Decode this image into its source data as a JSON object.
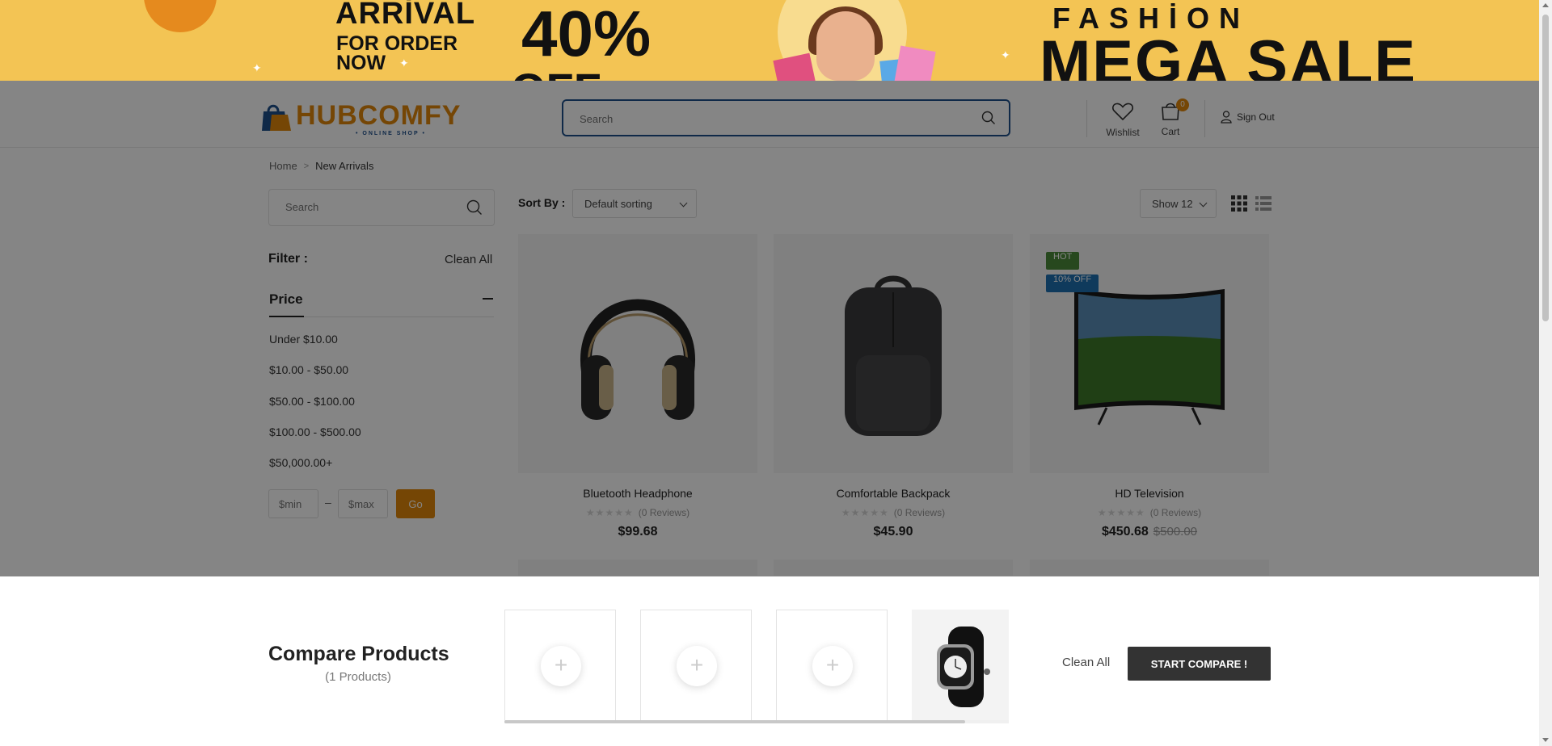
{
  "banner": {
    "arrival": "ARRİVAL",
    "for_order": "FOR ORDER",
    "now": "NOW",
    "percent": "40%",
    "off": "OFF",
    "fashion": "FASHİON",
    "mega_sale": "MEGA SALE",
    "bg_color": "#f3c454"
  },
  "header": {
    "logo_text": "HUBCOMFY",
    "logo_sub": "• ONLINE SHOP •",
    "search_placeholder": "Search",
    "wishlist_label": "Wishlist",
    "cart_label": "Cart",
    "cart_count": "0",
    "signout_label": "Sign Out",
    "accent_color": "#e0860a",
    "brand_color": "#1e4f8b"
  },
  "breadcrumb": {
    "home": "Home",
    "current": "New Arrivals"
  },
  "sidebar": {
    "search_placeholder": "Search",
    "filter_label": "Filter :",
    "clean_all": "Clean All",
    "price_title": "Price",
    "price_options": [
      "Under $10.00",
      "$10.00 - $50.00",
      "$50.00 - $100.00",
      "$100.00 - $500.00",
      "$50,000.00+"
    ],
    "min_placeholder": "$min",
    "max_placeholder": "$max",
    "range_dash": "–",
    "go_label": "Go"
  },
  "toolbar": {
    "sort_label": "Sort By :",
    "sort_value": "Default sorting",
    "show_value": "Show 12",
    "grid_icon": "grid-view-icon",
    "list_icon": "list-view-icon"
  },
  "products": [
    {
      "name": "Bluetooth Headphone",
      "stars": "★★★★★",
      "reviews": "(0 Reviews)",
      "price": "$99.68",
      "old_price": "",
      "tags": []
    },
    {
      "name": "Comfortable Backpack",
      "stars": "★★★★★",
      "reviews": "(0 Reviews)",
      "price": "$45.90",
      "old_price": "",
      "tags": []
    },
    {
      "name": "HD Television",
      "stars": "★★★★★",
      "reviews": "(0 Reviews)",
      "price": "$450.68",
      "old_price": "$500.00",
      "tags": [
        "HOT",
        "10% OFF"
      ]
    }
  ],
  "compare": {
    "title": "Compare Products",
    "count": "(1 Products)",
    "slot_plus": "+",
    "clean_all": "Clean All",
    "start_label": "START COMPARE !"
  }
}
